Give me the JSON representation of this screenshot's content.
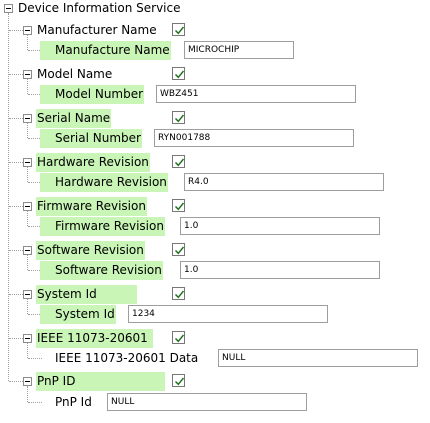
{
  "root": {
    "label": "Device Information Service"
  },
  "characteristics": [
    {
      "name": "Manufacturer Name",
      "enabled": true,
      "field_label": "Manufacture Name",
      "value": "MICROCHIP"
    },
    {
      "name": "Model Name",
      "enabled": true,
      "field_label": "Model Number",
      "value": "WBZ451"
    },
    {
      "name": "Serial Name",
      "enabled": true,
      "field_label": "Serial Number",
      "value": "RYN001788"
    },
    {
      "name": "Hardware Revision",
      "enabled": true,
      "field_label": "Hardware Revision",
      "value": "R4.0"
    },
    {
      "name": "Firmware Revision",
      "enabled": true,
      "field_label": "Firmware Revision",
      "value": "1.0"
    },
    {
      "name": "Software Revision",
      "enabled": true,
      "field_label": "Software Revision",
      "value": "1.0"
    },
    {
      "name": "System Id",
      "enabled": true,
      "field_label": "System Id",
      "value": "1234"
    },
    {
      "name": "IEEE 11073-20601",
      "enabled": true,
      "field_label": "IEEE 11073-20601 Data",
      "value": "NULL"
    },
    {
      "name": "PnP ID",
      "enabled": true,
      "field_label": "PnP Id",
      "value": "NULL"
    }
  ],
  "colors": {
    "highlight": "#c9f5b6",
    "tree_line": "#a0a0a0"
  },
  "icons": {
    "expander": "collapse-minus-icon",
    "check": "checkmark-icon"
  }
}
